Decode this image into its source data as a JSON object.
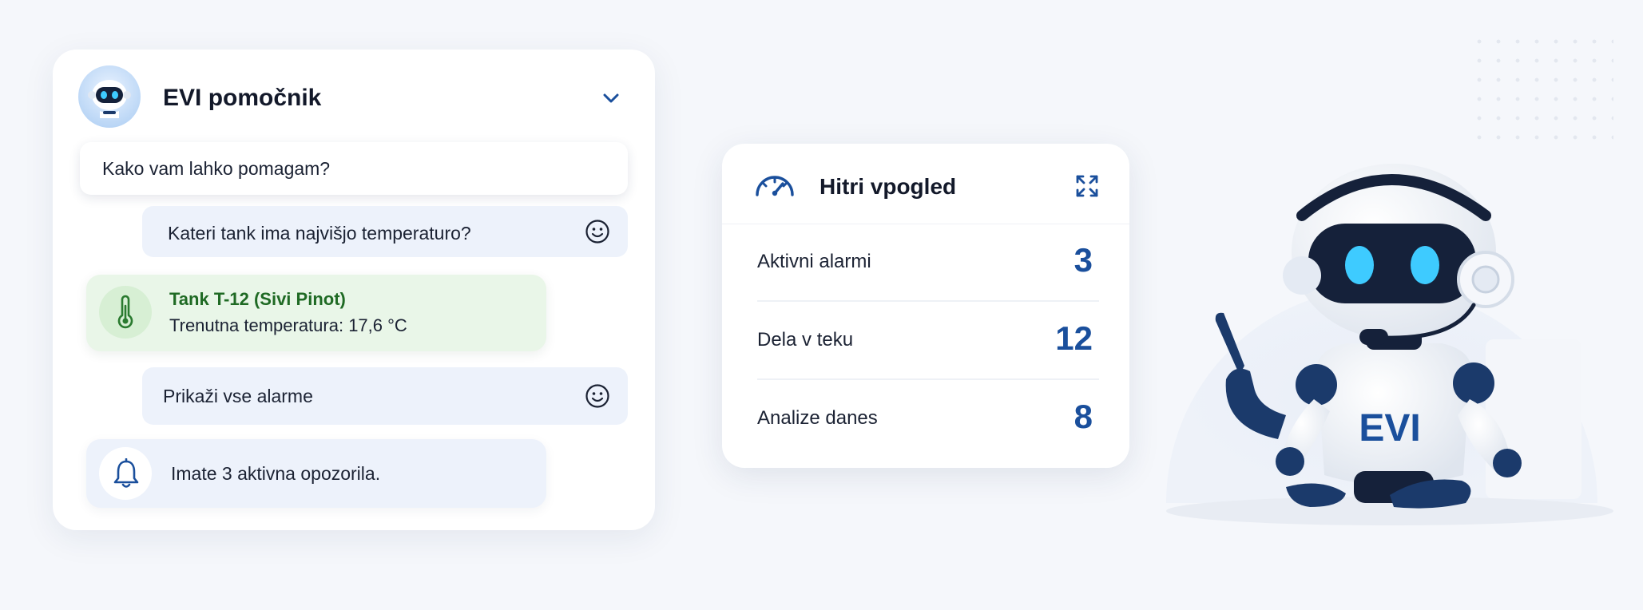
{
  "chat": {
    "title": "EVI pomočnik",
    "bot_greeting": "Kako vam lahko pomagam?",
    "user_question_1": "Kateri tank ima najvišjo temperaturo?",
    "tank_result": {
      "title": "Tank T-12 (Sivi Pinot)",
      "detail": "Trenutna temperatura: 17,6 °C"
    },
    "user_question_2": "Prikaži vse alarme",
    "alert_reply": "Imate 3 aktivna opozorila.",
    "icons": [
      "robot-avatar-icon",
      "chevron-down-icon",
      "smile-icon",
      "thermometer-icon",
      "bell-icon"
    ]
  },
  "quick_view": {
    "title": "Hitri vpogled",
    "icons": [
      "gauge-icon",
      "expand-icon"
    ],
    "stats": [
      {
        "label": "Aktivni alarmi",
        "value": "3"
      },
      {
        "label": "Dela v teku",
        "value": "12"
      },
      {
        "label": "Analize danes",
        "value": "8"
      }
    ]
  },
  "mascot": {
    "chest_label": "EVI"
  },
  "colors": {
    "accent_blue": "#1a4f9c",
    "navy": "#1b3a6b",
    "green_text": "#1f6a24",
    "green_bg": "#e9f6e8",
    "user_bubble_bg": "#edf2fb",
    "robot_eye": "#3ecbff"
  }
}
